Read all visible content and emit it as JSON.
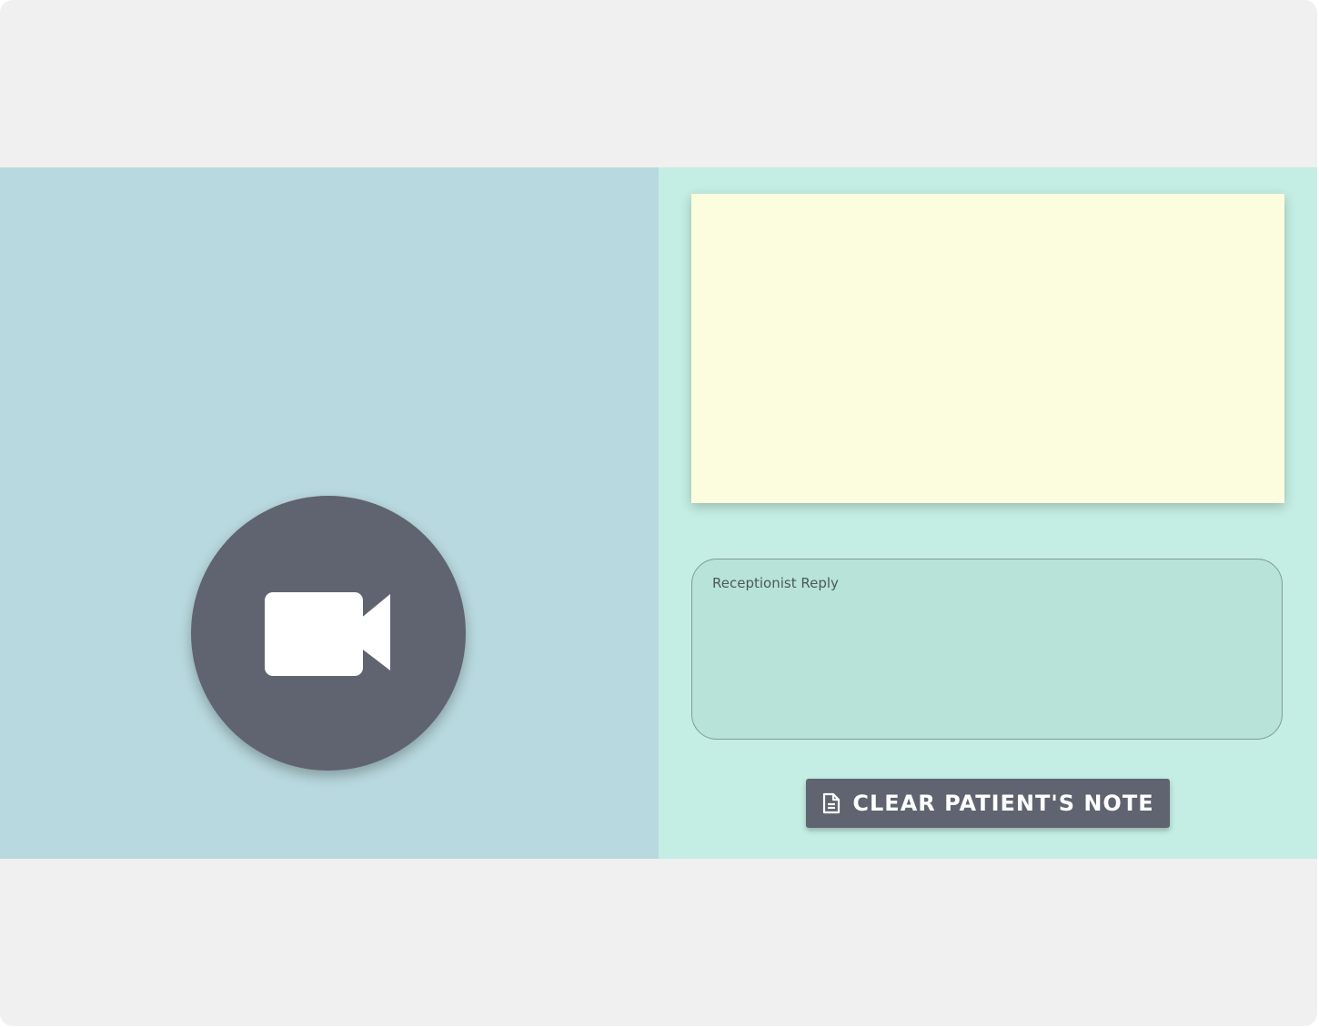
{
  "video": {
    "camera_icon": "videocam-icon",
    "button_color": "#5f6470",
    "panel_color": "#b8d9df"
  },
  "notes": {
    "panel_color": "#c4eee3",
    "patient_note_color": "#fcfcde",
    "reply": {
      "placeholder": "Receptionist Reply",
      "value": ""
    },
    "clear_button": {
      "icon": "note-icon",
      "label": "CLEAR PATIENT'S NOTE"
    }
  }
}
